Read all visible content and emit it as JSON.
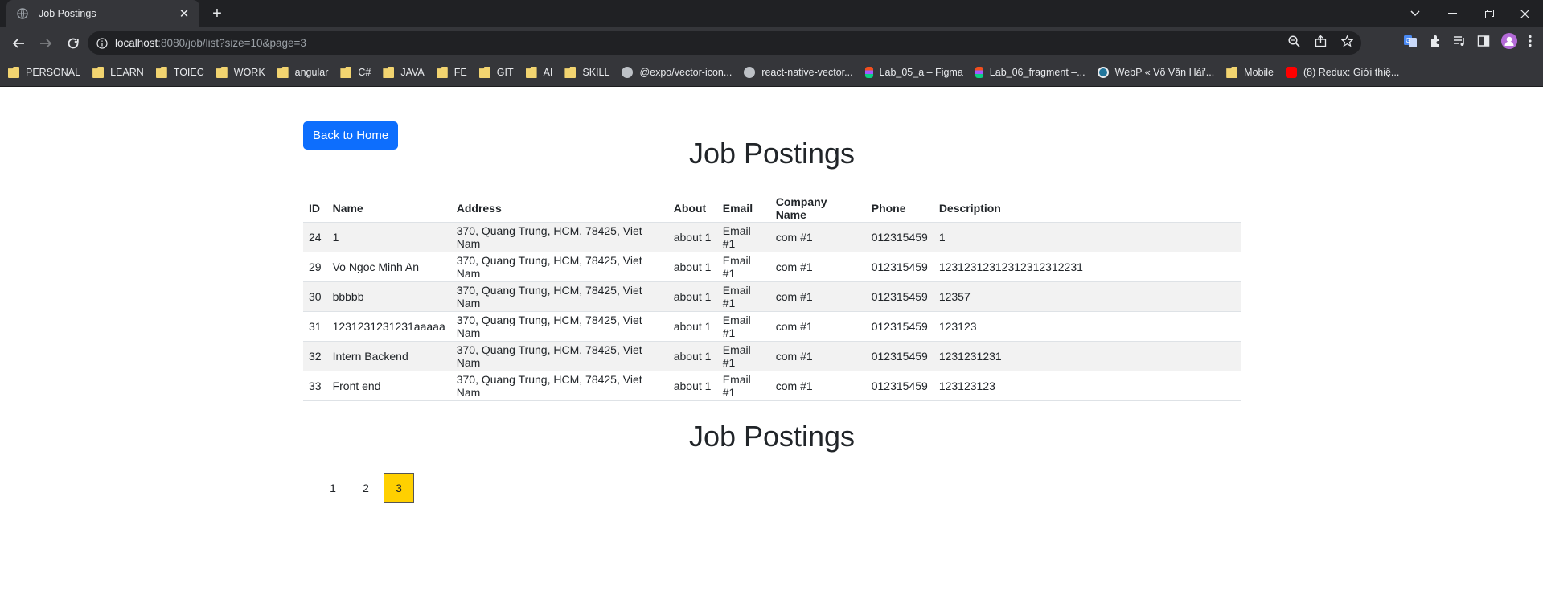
{
  "browser": {
    "tab_title": "Job Postings",
    "url_host": "localhost",
    "url_rest": ":8080/job/list?size=10&page=3",
    "bookmarks": [
      {
        "label": "PERSONAL",
        "icon": "folder-icon"
      },
      {
        "label": "LEARN",
        "icon": "folder-icon"
      },
      {
        "label": "TOIEC",
        "icon": "folder-icon"
      },
      {
        "label": "WORK",
        "icon": "folder-icon"
      },
      {
        "label": "angular",
        "icon": "folder-icon"
      },
      {
        "label": "C#",
        "icon": "folder-icon"
      },
      {
        "label": "JAVA",
        "icon": "folder-icon"
      },
      {
        "label": "FE",
        "icon": "folder-icon"
      },
      {
        "label": "GIT",
        "icon": "folder-icon"
      },
      {
        "label": "AI",
        "icon": "folder-icon"
      },
      {
        "label": "SKILL",
        "icon": "folder-icon"
      },
      {
        "label": "@expo/vector-icon...",
        "icon": "expo-icon"
      },
      {
        "label": "react-native-vector...",
        "icon": "globe-icon"
      },
      {
        "label": "Lab_05_a – Figma",
        "icon": "figma-icon"
      },
      {
        "label": "Lab_06_fragment –...",
        "icon": "figma-icon"
      },
      {
        "label": "WebP « Võ Văn Hải'...",
        "icon": "wordpress-icon"
      },
      {
        "label": "Mobile",
        "icon": "folder-icon"
      },
      {
        "label": "(8) Redux: Giới thiệ...",
        "icon": "youtube-icon"
      }
    ]
  },
  "page": {
    "back_button": "Back to Home",
    "title": "Job Postings",
    "second_title": "Job Postings",
    "table": {
      "headers": [
        "ID",
        "Name",
        "Address",
        "About",
        "Email",
        "Company Name",
        "Phone",
        "Description"
      ],
      "rows": [
        [
          "24",
          "1",
          "370, Quang Trung, HCM, 78425, Viet Nam",
          "about 1",
          "Email #1",
          "com #1",
          "012315459",
          "1"
        ],
        [
          "29",
          "Vo Ngoc Minh An",
          "370, Quang Trung, HCM, 78425, Viet Nam",
          "about 1",
          "Email #1",
          "com #1",
          "012315459",
          "12312312312312312312231"
        ],
        [
          "30",
          "bbbbb",
          "370, Quang Trung, HCM, 78425, Viet Nam",
          "about 1",
          "Email #1",
          "com #1",
          "012315459",
          "12357"
        ],
        [
          "31",
          "1231231231231aaaaa",
          "370, Quang Trung, HCM, 78425, Viet Nam",
          "about 1",
          "Email #1",
          "com #1",
          "012315459",
          "123123"
        ],
        [
          "32",
          "Intern Backend",
          "370, Quang Trung, HCM, 78425, Viet Nam",
          "about 1",
          "Email #1",
          "com #1",
          "012315459",
          "1231231231"
        ],
        [
          "33",
          "Front end",
          "370, Quang Trung, HCM, 78425, Viet Nam",
          "about 1",
          "Email #1",
          "com #1",
          "012315459",
          "123123123"
        ]
      ]
    },
    "pagination": {
      "pages": [
        "1",
        "2",
        "3"
      ],
      "current": "3",
      "active_color": "#ffd000"
    },
    "accent_color": "#0d6efd"
  }
}
